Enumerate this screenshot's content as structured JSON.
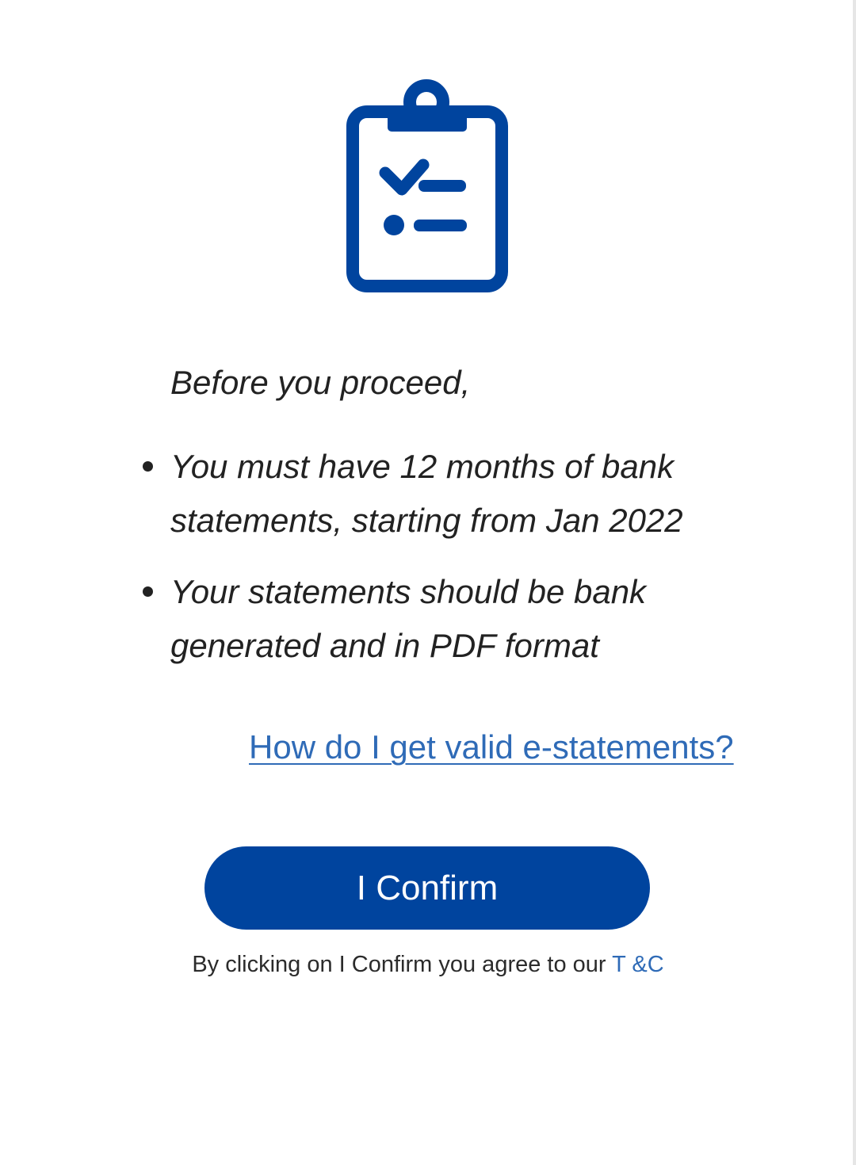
{
  "icons": {
    "hero": "clipboard-checklist-icon"
  },
  "colors": {
    "brand": "#00449e",
    "link": "#2f6bb7",
    "text": "#222222",
    "background": "#ffffff"
  },
  "intro": "Before you proceed,",
  "requirements": [
    "You must have 12 months of bank statements, starting from Jan 2022",
    "Your statements should be bank generated and in PDF format"
  ],
  "help_link": "How do I get valid e-statements?",
  "confirm_button": "I Confirm",
  "terms": {
    "prefix": "By clicking on I Confirm you agree to our ",
    "link": "T &C"
  }
}
